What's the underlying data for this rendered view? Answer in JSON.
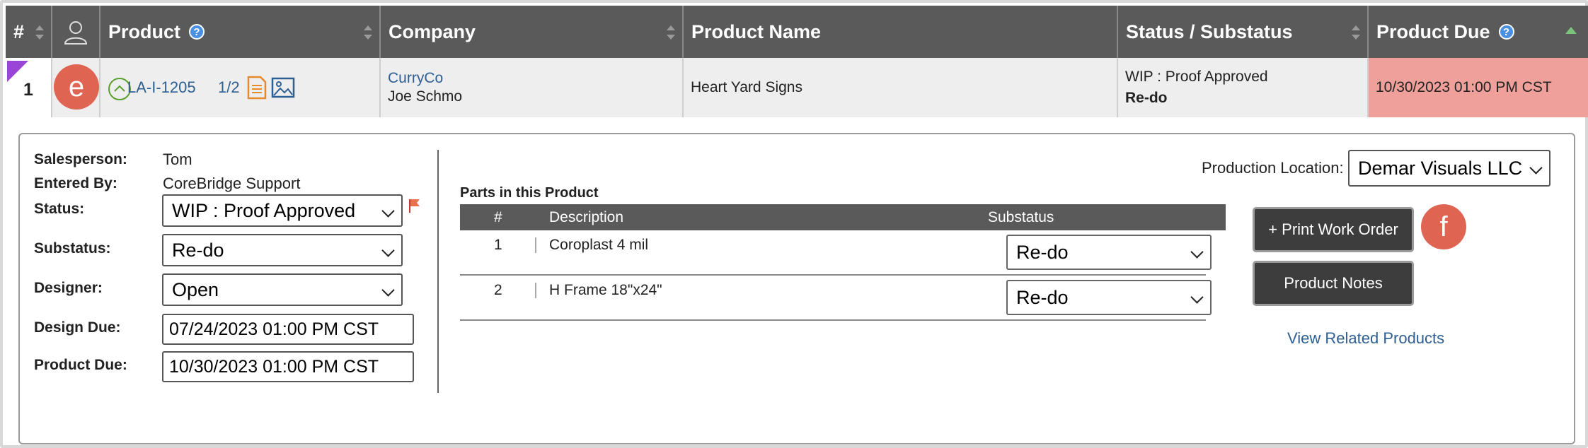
{
  "header": {
    "num": "#",
    "product": "Product",
    "company": "Company",
    "product_name": "Product Name",
    "status": "Status / Substatus",
    "product_due": "Product Due"
  },
  "row": {
    "index": "1",
    "badge_e": "e",
    "product_code": "LA-I-1205",
    "fraction": "1/2",
    "company": "CurryCo",
    "contact": "Joe Schmo",
    "product_name": "Heart Yard Signs",
    "status": "WIP : Proof Approved",
    "substatus": "Re-do",
    "due": "10/30/2023 01:00 PM CST"
  },
  "details": {
    "salesperson_label": "Salesperson:",
    "salesperson": "Tom",
    "entered_by_label": "Entered By:",
    "entered_by": "CoreBridge Support",
    "status_label": "Status:",
    "status": "WIP : Proof Approved",
    "substatus_label": "Substatus:",
    "substatus": "Re-do",
    "designer_label": "Designer:",
    "designer": "Open",
    "design_due_label": "Design Due:",
    "design_due": "07/24/2023 01:00 PM CST",
    "product_due_label": "Product Due:",
    "product_due": "10/30/2023 01:00 PM CST"
  },
  "parts": {
    "title": "Parts in this Product",
    "col_num": "#",
    "col_desc": "Description",
    "col_sub": "Substatus",
    "rows": [
      {
        "num": "1",
        "desc": "Coroplast 4 mil",
        "substatus": "Re-do"
      },
      {
        "num": "2",
        "desc": "H Frame 18\"x24\"",
        "substatus": "Re-do"
      }
    ]
  },
  "actions": {
    "location_label": "Production Location:",
    "location": "Demar Visuals LLC",
    "print_btn": "+ Print Work Order",
    "badge_f": "f",
    "notes_btn": "Product Notes",
    "related_link": "View Related Products"
  },
  "colors": {
    "header_bg": "#5a5a5a",
    "due_highlight": "#f0a09a",
    "badge": "#e06452",
    "link": "#2e5f93"
  }
}
